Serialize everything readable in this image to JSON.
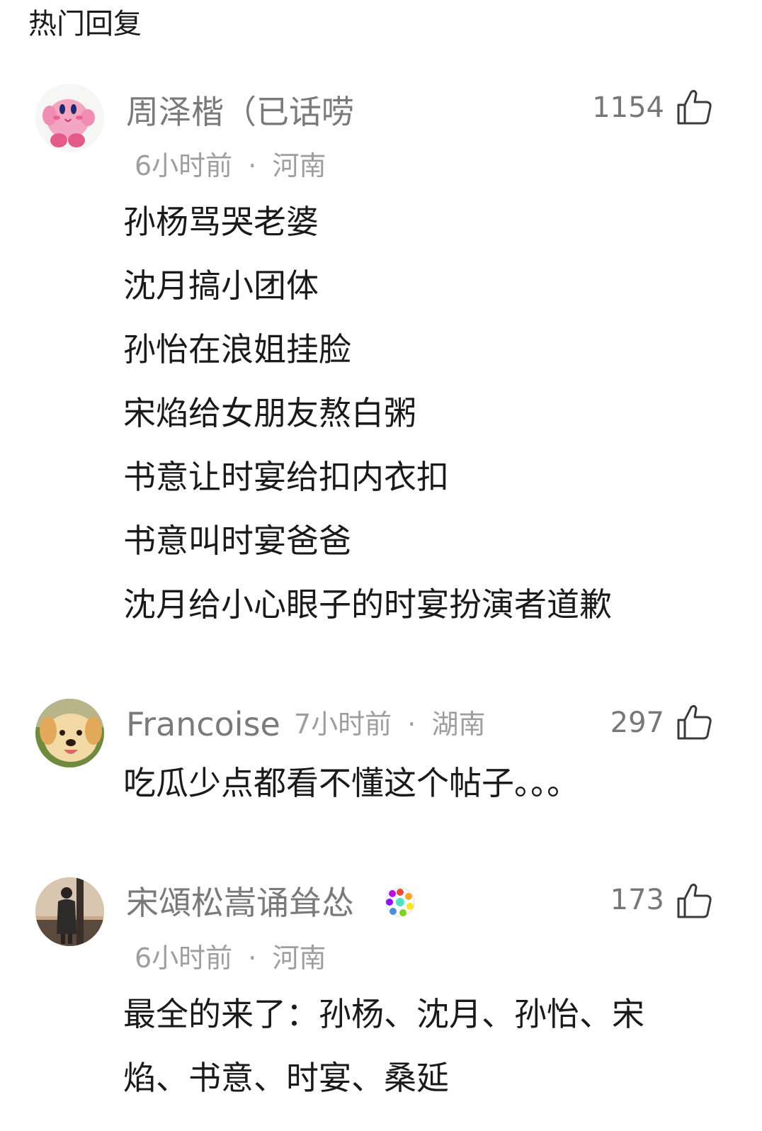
{
  "header": {
    "title": "热门回复"
  },
  "comments": [
    {
      "username": "周泽楷（已话唠",
      "time": "6小时前",
      "location": "河南",
      "likes": "1154",
      "lines": [
        "孙杨骂哭老婆",
        "沈月搞小团体",
        "孙怡在浪姐挂脸",
        "宋焰给女朋友熬白粥",
        "书意让时宴给扣内衣扣",
        "书意叫时宴爸爸",
        "沈月给小心眼子的时宴扮演者道歉"
      ],
      "avatar": "kirby-avatar"
    },
    {
      "username": "Francoise",
      "time": "7小时前",
      "location": "湖南",
      "likes": "297",
      "lines": [
        "吃瓜少点都看不懂这个帖子。。。"
      ],
      "avatar": "puppy-avatar"
    },
    {
      "username": "宋頌松嵩诵耸怂",
      "time": "6小时前",
      "location": "河南",
      "likes": "173",
      "lines": [
        "最全的来了：孙杨、沈月、孙怡、宋",
        "焰、书意、时宴、桑延"
      ],
      "avatar": "person-avatar",
      "badge": "colorful-badge-icon"
    }
  ],
  "icons": {
    "like": "thumbs-up-icon"
  },
  "colors": {
    "username": "#7a7a7a",
    "meta": "#9e9e9e",
    "text": "#1a1a1a"
  },
  "meta_separator": "·"
}
